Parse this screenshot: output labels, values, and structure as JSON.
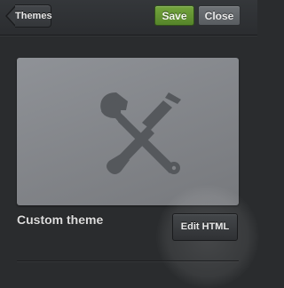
{
  "header": {
    "back_label": "Themes",
    "save_label": "Save",
    "close_label": "Close"
  },
  "theme": {
    "name": "Custom theme",
    "edit_label": "Edit HTML",
    "preview_icon": "wrench-screwdriver-icon"
  },
  "colors": {
    "save": "#5f9131",
    "background": "#2a2c2e"
  }
}
